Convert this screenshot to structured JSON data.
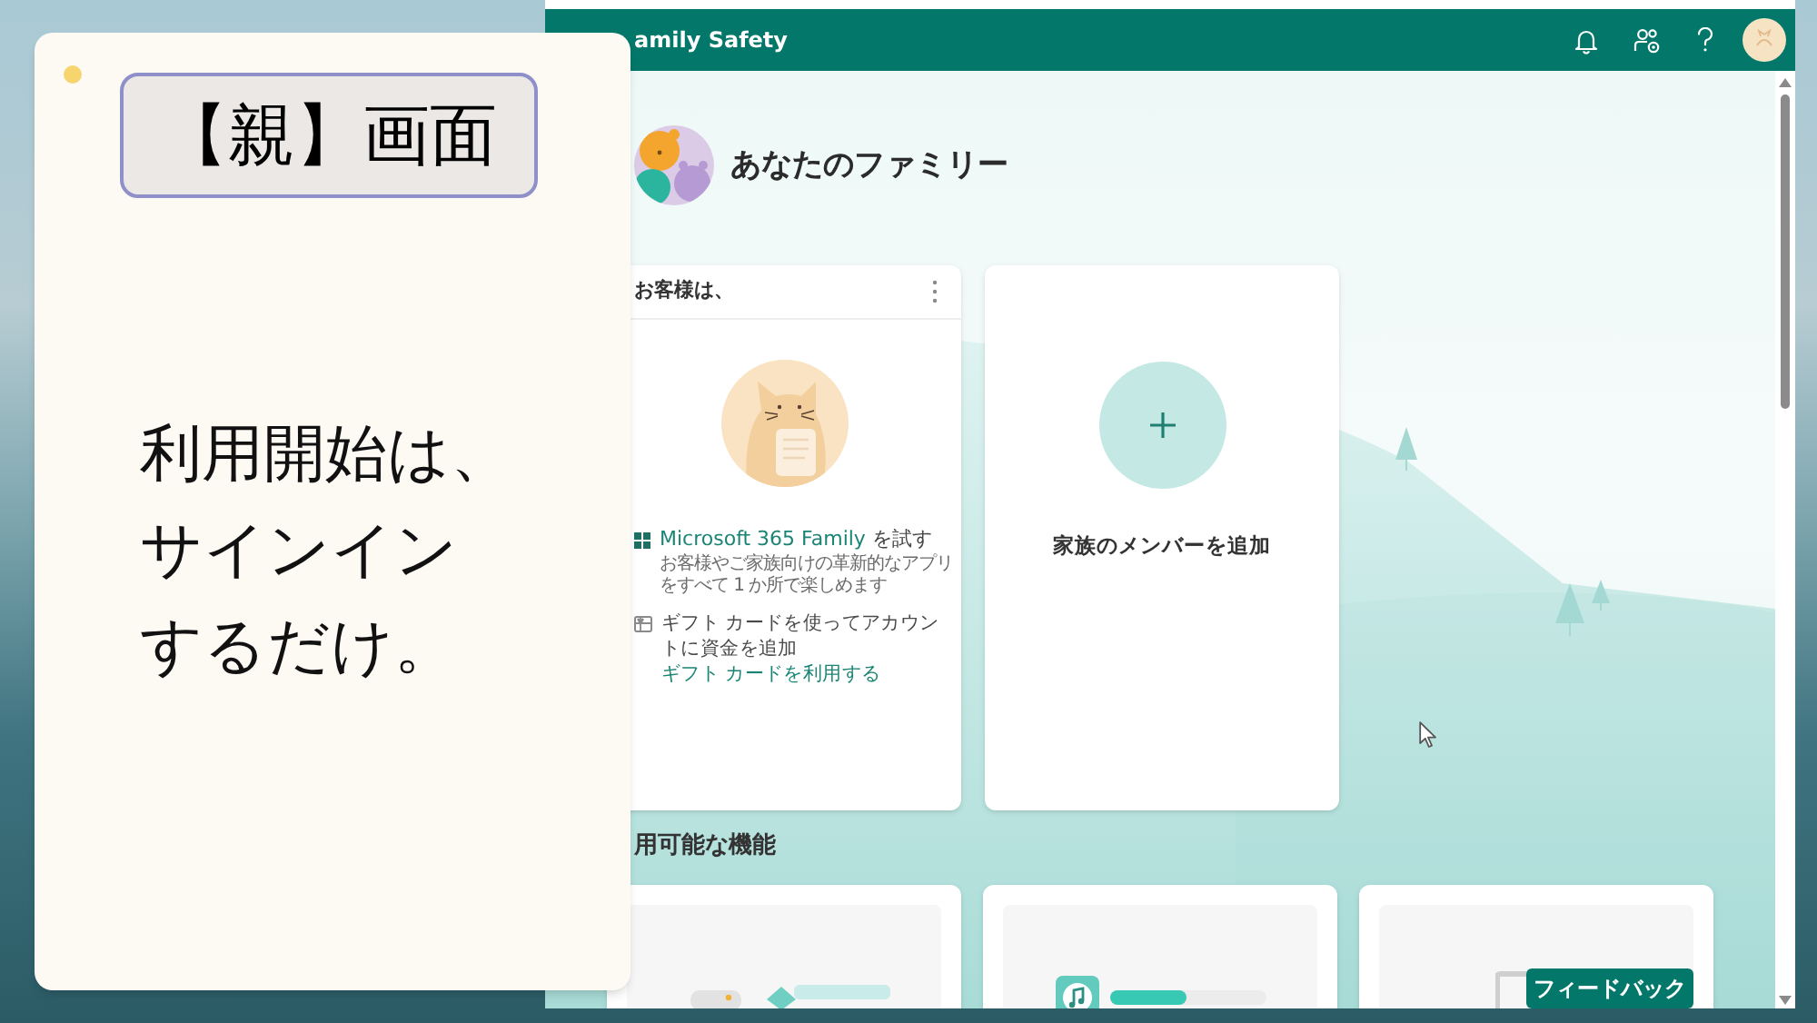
{
  "note_card": {
    "title": "【親】画面",
    "lines": [
      "利用開始は、",
      "サインイン",
      "するだけ。"
    ]
  },
  "header": {
    "title": "amily Safety"
  },
  "family": {
    "title": "あなたのファミリー"
  },
  "account_card": {
    "title": "お客様は、",
    "offers": [
      {
        "kind": "app",
        "link": "Microsoft 365 Family",
        "text": "を試す",
        "description": "お客様やご家族向けの革新的なアプリをすべて 1 か所で楽しめます"
      },
      {
        "kind": "gift",
        "text": "ギフト カードを使ってアカウントに資金を追加",
        "link": "ギフト カードを利用する"
      }
    ]
  },
  "add_member_card": {
    "label": "家族のメンバーを追加"
  },
  "features": {
    "title": "用可能な機能",
    "cards": [
      {
        "kind": "game"
      },
      {
        "kind": "music"
      },
      {
        "kind": "device"
      }
    ]
  },
  "feedback_button": {
    "label": "フィードバック"
  }
}
